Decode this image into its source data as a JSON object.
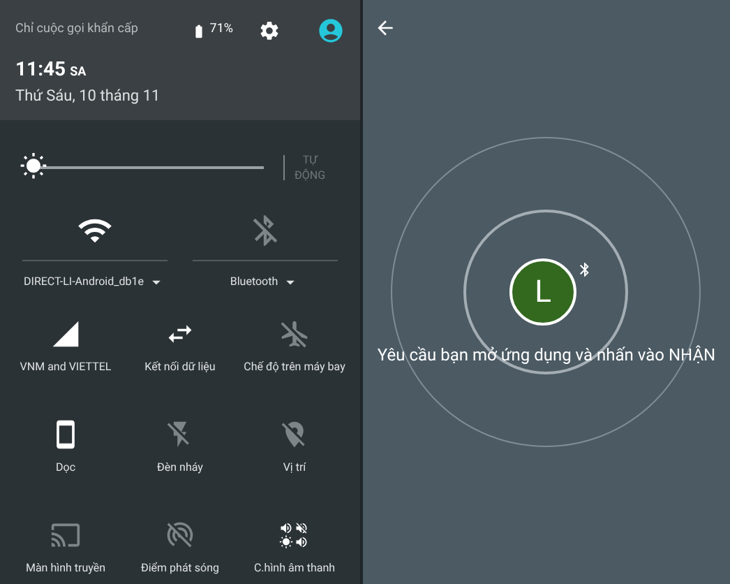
{
  "status": {
    "carrier": "Chỉ cuộc gọi khẩn cấp",
    "battery": "71%"
  },
  "clock": {
    "time": "11:45",
    "ampm": "SA",
    "date": "Thứ Sáu, 10 tháng 11"
  },
  "brightness": {
    "level": 0.0,
    "auto_label": "TỰ ĐỘNG",
    "auto_on": false
  },
  "big_tiles": [
    {
      "label": "DIRECT-LI-Android_db1e",
      "on": true
    },
    {
      "label": "Bluetooth",
      "on": false
    }
  ],
  "tiles": [
    {
      "label": "VNM and VIETTEL",
      "on": true
    },
    {
      "label": "Kết nối dữ liệu",
      "on": true
    },
    {
      "label": "Chế độ trên máy bay",
      "on": false
    },
    {
      "label": "Dọc",
      "on": true
    },
    {
      "label": "Đèn nháy",
      "on": false
    },
    {
      "label": "Vị trí",
      "on": false
    },
    {
      "label": "Màn hình truyền",
      "on": false
    },
    {
      "label": "Điểm phát sóng",
      "on": false
    },
    {
      "label": "C.hình âm thanh",
      "on": true
    }
  ],
  "share": {
    "avatar_letter": "L",
    "message": "Yêu cầu bạn mở ứng dụng và nhấn vào NHẬN"
  }
}
